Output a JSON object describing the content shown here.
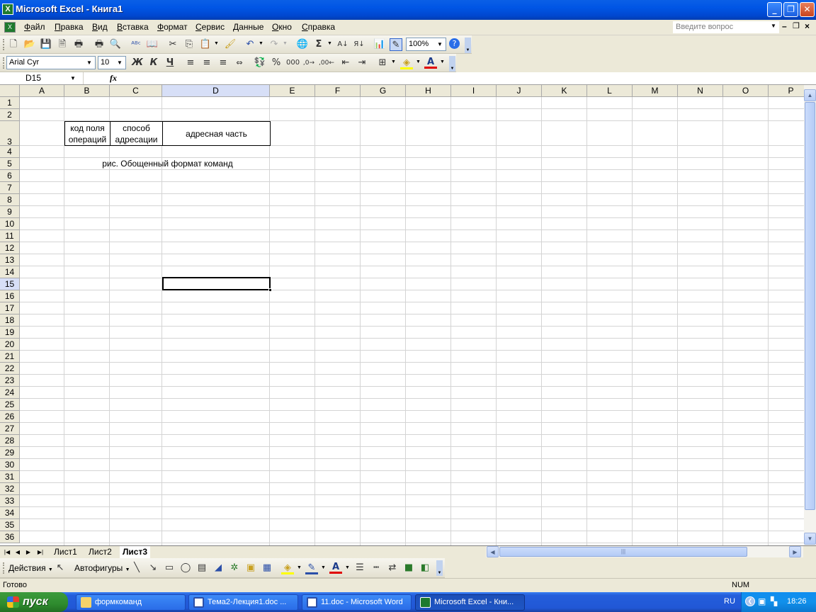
{
  "window": {
    "title": "Microsoft Excel - Книга1"
  },
  "menu": {
    "items": [
      "Файл",
      "Правка",
      "Вид",
      "Вставка",
      "Формат",
      "Сервис",
      "Данные",
      "Окно",
      "Справка"
    ],
    "ask_placeholder": "Введите вопрос"
  },
  "toolbar": {
    "zoom": "100%"
  },
  "format": {
    "font": "Arial Cyr",
    "size": "10",
    "bold": "Ж",
    "italic": "К",
    "underline": "Ч"
  },
  "formula_bar": {
    "name_box": "D15",
    "fx": "fx",
    "content": ""
  },
  "sheet": {
    "columns": [
      "A",
      "B",
      "C",
      "D",
      "E",
      "F",
      "G",
      "H",
      "I",
      "J",
      "K",
      "L",
      "M",
      "N",
      "O",
      "P"
    ],
    "rows": [
      "1",
      "2",
      "3",
      "4",
      "5",
      "6",
      "7",
      "8",
      "9",
      "10",
      "11",
      "12",
      "13",
      "14",
      "15",
      "16",
      "17",
      "18",
      "19",
      "20",
      "21",
      "22",
      "23",
      "24",
      "25",
      "26",
      "27",
      "28",
      "29",
      "30",
      "31",
      "32",
      "33",
      "34",
      "35",
      "36"
    ],
    "selected_column": "D",
    "selected_row": "15",
    "cells": {
      "b3_line1": "код поля",
      "b3_line2": "операций",
      "c3_line1": "способ",
      "c3_line2": "адресации",
      "d3": "адресная часть",
      "b5": "рис. Обощенный формат команд"
    }
  },
  "tabs": {
    "sheets": [
      "Лист1",
      "Лист2",
      "Лист3"
    ],
    "active": "Лист3"
  },
  "drawing": {
    "actions": "Действия",
    "autoshapes": "Автофигуры"
  },
  "status": {
    "left": "Готово",
    "num": "NUM"
  },
  "taskbar": {
    "start": "пуск",
    "tasks": [
      {
        "label": "формкоманд",
        "active": false
      },
      {
        "label": "Тема2-Лекция1.doc ...",
        "active": false
      },
      {
        "label": "11.doc - Microsoft Word",
        "active": false
      },
      {
        "label": "Microsoft Excel - Кни...",
        "active": true
      }
    ],
    "lang": "RU",
    "clock": "18:26"
  },
  "colors": {
    "accent": "#0055e5",
    "selection": "#d7dff7",
    "grid": "#d4d4d4"
  }
}
